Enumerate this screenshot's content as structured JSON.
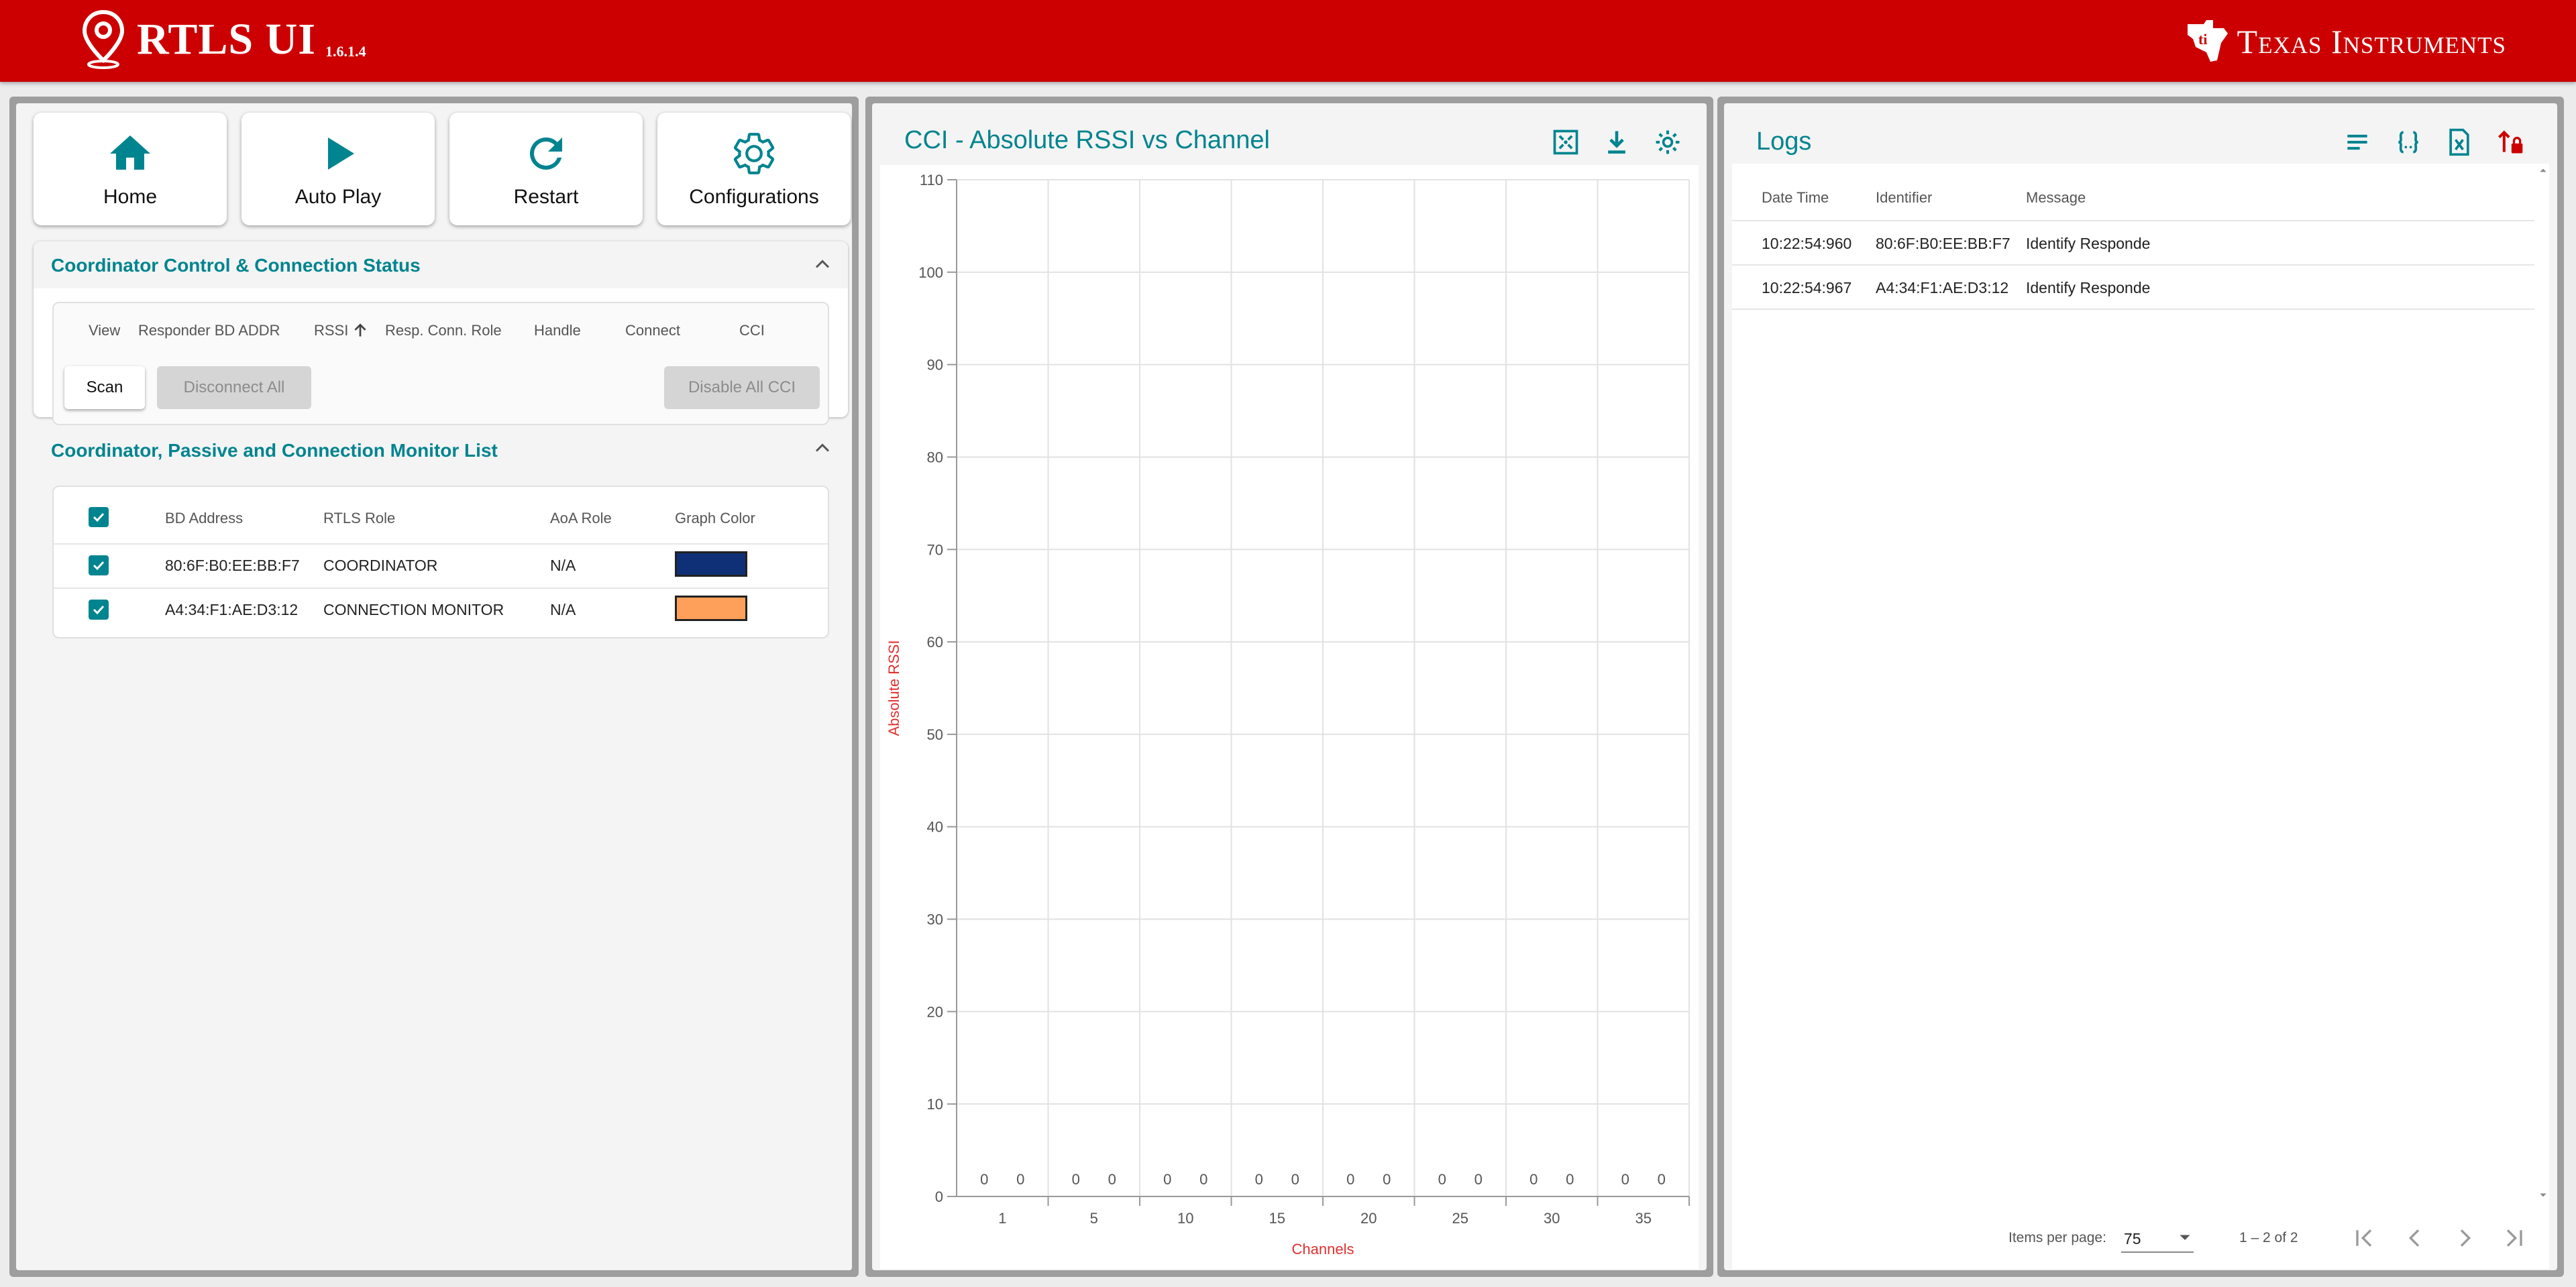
{
  "header": {
    "app_title": "RTLS UI",
    "version": "1.6.1.4",
    "brand": "Texas Instruments",
    "bg_color": "#cc0000"
  },
  "nav": {
    "home_label": "Home",
    "autoplay_label": "Auto Play",
    "restart_label": "Restart",
    "config_label": "Configurations"
  },
  "control": {
    "title": "Coordinator Control & Connection Status",
    "columns": [
      "View",
      "Responder BD ADDR",
      "RSSI",
      "Resp. Conn. Role",
      "Handle",
      "Connect",
      "CCI"
    ],
    "scan_label": "Scan",
    "disconnect_all_label": "Disconnect All",
    "disable_cci_label": "Disable All CCI"
  },
  "monitor": {
    "title": "Coordinator, Passive and Connection Monitor List",
    "columns": [
      "BD Address",
      "RTLS Role",
      "AoA Role",
      "Graph Color"
    ],
    "rows": [
      {
        "bd": "80:6F:B0:EE:BB:F7",
        "role": "COORDINATOR",
        "aoa": "N/A",
        "color": "#0f3076",
        "checked": true
      },
      {
        "bd": "A4:34:F1:AE:D3:12",
        "role": "CONNECTION MONITOR",
        "aoa": "N/A",
        "color": "#ffa05a",
        "checked": true
      }
    ]
  },
  "chart_panel": {
    "title": "CCI - Absolute RSSI vs Channel"
  },
  "chart_data": {
    "type": "bar",
    "xlabel": "Channels",
    "ylabel": "Absolute RSSI",
    "ylim": [
      0,
      110
    ],
    "yticks": [
      0,
      10,
      20,
      30,
      40,
      50,
      60,
      70,
      80,
      90,
      100,
      110
    ],
    "categories": [
      "1",
      "5",
      "10",
      "15",
      "20",
      "25",
      "30",
      "35"
    ],
    "series": [
      {
        "name": "80:6F:B0:EE:BB:F7",
        "color": "#0f3076",
        "values": [
          0,
          0,
          0,
          0,
          0,
          0,
          0,
          0
        ]
      },
      {
        "name": "A4:34:F1:AE:D3:12",
        "color": "#ffa05a",
        "values": [
          0,
          0,
          0,
          0,
          0,
          0,
          0,
          0
        ]
      }
    ],
    "grid": true,
    "axis_label_color": "#e03030"
  },
  "logs": {
    "title": "Logs",
    "columns": [
      "Date Time",
      "Identifier",
      "Message"
    ],
    "rows": [
      {
        "time": "10:22:54:960",
        "id": "80:6F:B0:EE:BB:F7",
        "msg": "Identify Responde"
      },
      {
        "time": "10:22:54:967",
        "id": "A4:34:F1:AE:D3:12",
        "msg": "Identify Responde"
      }
    ],
    "items_per_page_label": "Items per page:",
    "items_per_page": "75",
    "range_label": "1 – 2 of 2"
  }
}
